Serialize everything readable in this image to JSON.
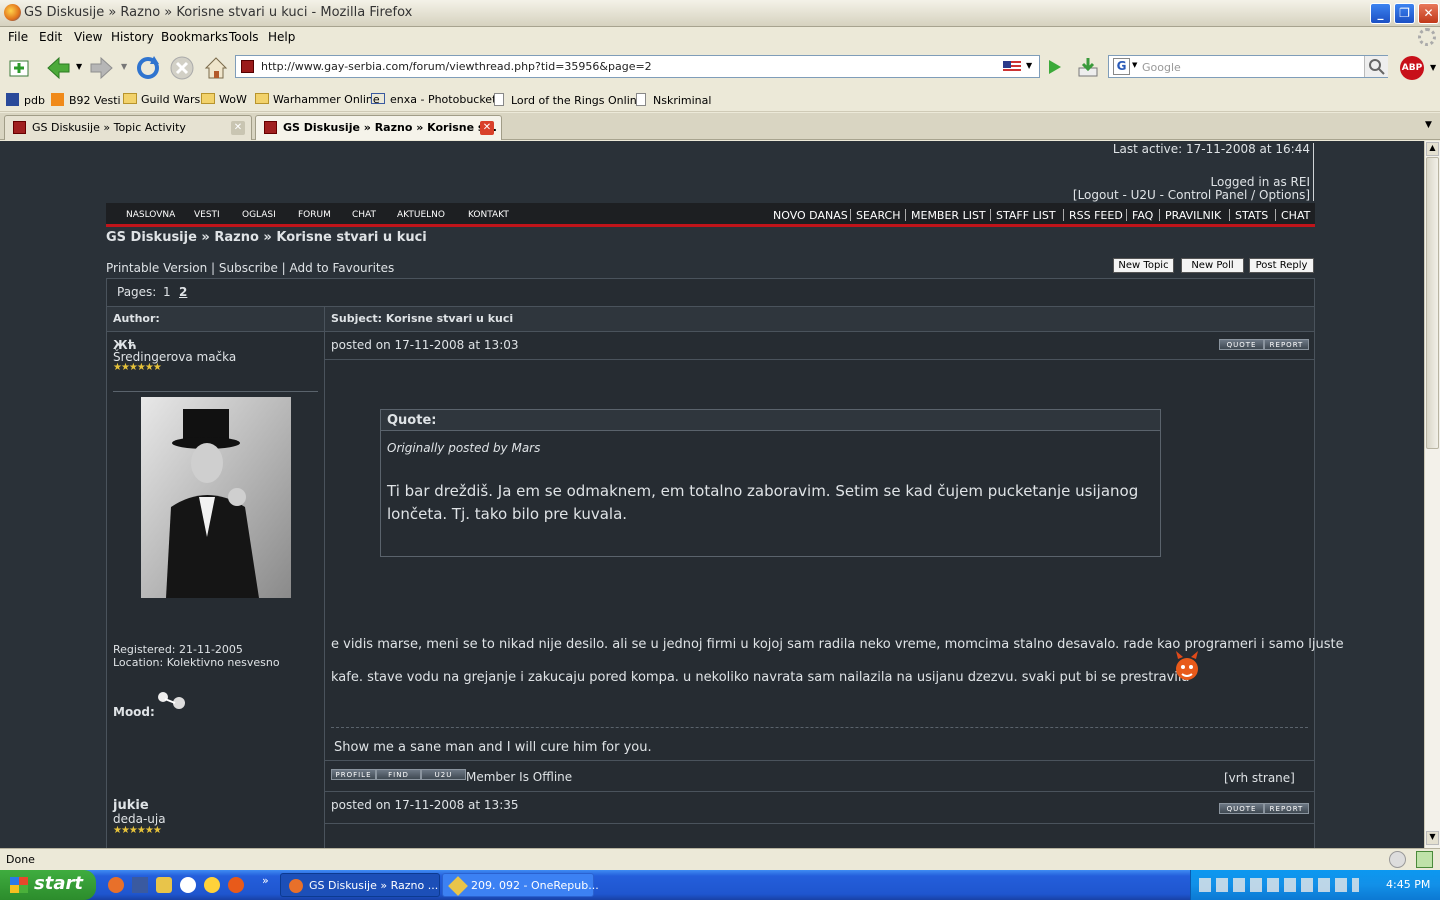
{
  "window": {
    "title": "GS Diskusije » Razno » Korisne stvari u kuci - Mozilla Firefox"
  },
  "menu": [
    "File",
    "Edit",
    "View",
    "History",
    "Bookmarks",
    "Tools",
    "Help"
  ],
  "nav": {
    "url": "http://www.gay-serbia.com/forum/viewthread.php?tid=35956&page=2",
    "search_placeholder": "Google"
  },
  "bookmarks": [
    "pdb",
    "B92 Vesti",
    "Guild Wars",
    "WoW",
    "Warhammer Online",
    "enxa - Photobucket",
    "Lord of the Rings Online",
    "Nskriminal"
  ],
  "tabs": [
    {
      "label": "GS Diskusije » Topic Activity",
      "active": false
    },
    {
      "label": "GS Diskusije » Razno » Korisne s...",
      "active": true
    }
  ],
  "forum": {
    "last_active": "Last active: 17-11-2008 at 16:44",
    "logged_in": "Logged in as REI",
    "account_links": "[Logout - U2U - Control Panel / Options]",
    "left_nav": [
      "NASLOVNA",
      "VESTI",
      "OGLASI",
      "FORUM",
      "CHAT",
      "AKTUELNO",
      "KONTAKT"
    ],
    "right_nav": [
      "NOVO DANAS",
      "SEARCH",
      "MEMBER LIST",
      "STAFF LIST",
      "RSS FEED",
      "FAQ",
      "PRAVILNIK",
      "STATS",
      "CHAT"
    ],
    "breadcrumb": "GS Diskusije  » Razno » Korisne stvari u kuci",
    "tools": "Printable Version | Subscribe | Add to Favourites",
    "buttons": [
      "New Topic",
      "New Poll",
      "Post Reply"
    ],
    "pages_label": "Pages:",
    "pages": [
      "1",
      "2"
    ],
    "author_header": "Author:",
    "subject_header": "Subject: Korisne stvari u kuci",
    "post1": {
      "author": "Жћ",
      "rank": "Šredingerova mačka",
      "stars": "★★★★★★",
      "date": "posted on 17-11-2008 at 13:03",
      "quote_title": "Quote:",
      "quote_by": "Originally posted by Mars",
      "quote_text": "Ti bar dreždiš. Ja em se odmaknem, em totalno zaboravim. Setim se kad čujem pucketanje usijanog lončeta. Tj. tako bilo pre kuvala.",
      "body_line1": "e vidis marse, meni se to nikad nije desilo. ali se u jednoj firmi u kojoj sam radila neko vreme, momcima stalno desavalo. rade kao programeri i samo ljuste",
      "body_line2": "kafe. stave vodu na grejanje i zakucaju pored kompa. u nekoliko navrata sam nailazila na usijanu dzezvu. svaki put bi se prestravila",
      "signature": "Show me a sane man and I will cure him for you.",
      "registered": "Registered: 21-11-2005",
      "location": "Location: Kolektivno nesvesno",
      "mood": "Mood:",
      "status": "Member Is Offline",
      "top_link": "[vrh strane]"
    },
    "post2": {
      "author": "jukie",
      "rank": "deda-uja",
      "stars": "★★★★★★",
      "date": "posted on 17-11-2008 at 13:35"
    },
    "small_buttons": {
      "quote": "QUOTE",
      "report": "REPORT",
      "profile": "PROFILE",
      "find": "FIND",
      "u2u": "U2U"
    }
  },
  "statusbar": {
    "text": "Done"
  },
  "taskbar": {
    "start": "start",
    "tasks": [
      "GS Diskusije » Razno ...",
      "209. 092 - OneRepub..."
    ],
    "clock": "4:45 PM"
  }
}
